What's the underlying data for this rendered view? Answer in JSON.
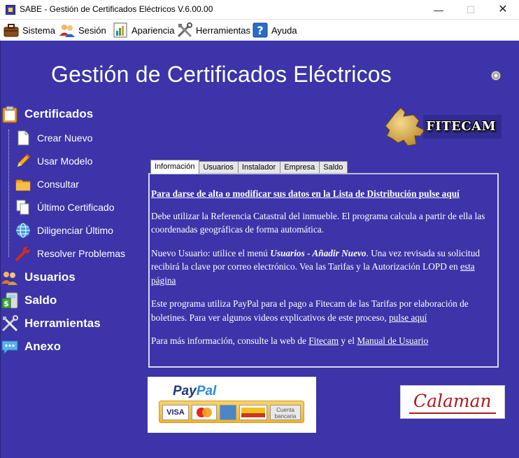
{
  "window": {
    "title": "SABE - Gestión de Certificados Eléctricos V.6.00.00",
    "minimize": "—",
    "maximize": "☐",
    "close": "✕"
  },
  "menu": [
    {
      "label": "Sistema",
      "icon": "briefcase-icon"
    },
    {
      "label": "Sesión",
      "icon": "users-icon"
    },
    {
      "label": "Apariencia",
      "icon": "chart-icon"
    },
    {
      "label": "Herramientas",
      "icon": "tools-icon"
    },
    {
      "label": "Ayuda",
      "icon": "help-icon"
    }
  ],
  "header": {
    "title": "Gestión de Certificados Eléctricos"
  },
  "sidebar": {
    "certificados": {
      "label": "Certificados",
      "items": [
        {
          "label": "Crear Nuevo",
          "icon": "new-document-icon"
        },
        {
          "label": "Usar Modelo",
          "icon": "pencil-icon"
        },
        {
          "label": "Consultar",
          "icon": "folder-icon"
        },
        {
          "label": "Último Certificado",
          "icon": "documents-icon"
        },
        {
          "label": "Diligenciar Último",
          "icon": "globe-icon"
        },
        {
          "label": "Resolver Problemas",
          "icon": "wrench-icon"
        }
      ]
    },
    "usuarios": {
      "label": "Usuarios"
    },
    "saldo": {
      "label": "Saldo"
    },
    "herramientas": {
      "label": "Herramientas"
    },
    "anexo": {
      "label": "Anexo"
    }
  },
  "logo": {
    "text": "FITECAM"
  },
  "tabs": [
    "Información",
    "Usuarios",
    "Instalador",
    "Empresa",
    "Saldo"
  ],
  "info": {
    "lead_link": "Para darse de alta o modificar sus datos en la Lista de Distribución pulse aquí",
    "p1": "Debe utilizar la Referencia Catastral del inmueble. El programa calcula a partir de ella las coordenadas geográficas de forma automática.",
    "p2_a": "Nuevo Usuario: utilice el menú ",
    "p2_em": "Usuarios - Añadir Nuevo",
    "p2_b": ". Una vez revisada su solicitud recibirá la clave por correo electrónico. Vea las Tarifas y la Autorización LOPD en ",
    "p2_link": "esta página",
    "p3_a": "Este programa utiliza PayPal para el pago a Fitecam de las Tarifas por elaboración de boletines. Para ver algunos videos explicativos de este proceso, ",
    "p3_link": "pulse aquí",
    "p4_a": "Para más información, consulte la web de ",
    "p4_link1": "Fitecam",
    "p4_b": " y el ",
    "p4_link2": "Manual de Usuario"
  },
  "paypal": {
    "word1": "Pay",
    "word2": "Pal",
    "cards": [
      "VISA",
      "MasterCard",
      "AMEX",
      "Aurora"
    ],
    "cuenta": "Cuenta",
    "bancaria": "bancaria"
  },
  "calaman": {
    "text": "Calaman"
  },
  "colors": {
    "background": "#3c34a8",
    "accent_red": "#b0181c"
  }
}
